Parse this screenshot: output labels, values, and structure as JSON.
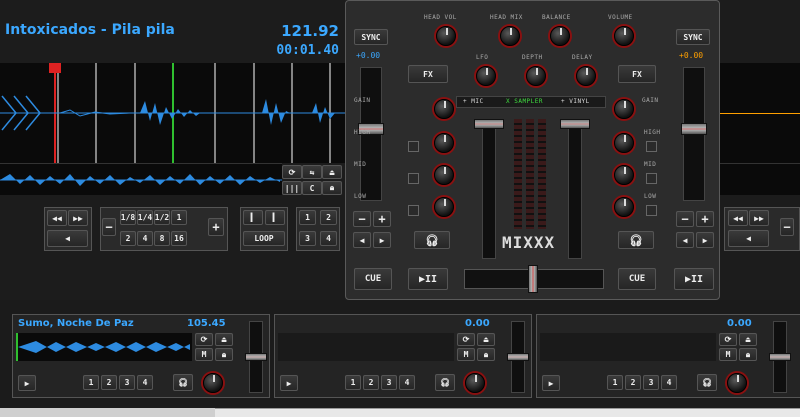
{
  "deck1": {
    "title": "Intoxicados - Pila pila",
    "bpm": "121.92",
    "time": "00:01.40",
    "pitch": "+0.00",
    "sync_label": "SYNC",
    "fx_label": "FX",
    "cue_label": "CUE",
    "play_label": "▶II",
    "loop_label": "LOOP",
    "loop_sizes_top": [
      "1/8",
      "1/4",
      "1/2",
      "1"
    ],
    "loop_sizes_bottom": [
      "2",
      "4",
      "8",
      "16"
    ],
    "hotcues_top": [
      "1",
      "2"
    ],
    "hotcues_bottom": [
      "3",
      "4"
    ],
    "minus": "−",
    "plus": "+"
  },
  "deck2": {
    "pitch": "+0.00",
    "sync_label": "SYNC",
    "fx_label": "FX",
    "cue_label": "CUE",
    "play_label": "▶II"
  },
  "mixer": {
    "top_knobs": [
      "HEAD VOL",
      "HEAD MIX",
      "BALANCE",
      "VOLUME"
    ],
    "mid_knobs": [
      "LFO",
      "DEPTH",
      "DELAY"
    ],
    "eq_labels": [
      "GAIN",
      "HIGH",
      "MID",
      "LOW"
    ],
    "channel_select": [
      "+ MIC",
      "X SAMPLER",
      "+ VINYL"
    ],
    "logo": "MIXXX"
  },
  "samplers": [
    {
      "title": "Sumo, Noche De Paz",
      "bpm": "105.45",
      "pads": [
        "1",
        "2",
        "3",
        "4"
      ],
      "play": "▶"
    },
    {
      "title": "",
      "bpm": "0.00",
      "pads": [
        "1",
        "2",
        "3",
        "4"
      ],
      "play": "▶"
    },
    {
      "title": "",
      "bpm": "0.00",
      "pads": [
        "1",
        "2",
        "3",
        "4"
      ],
      "play": "▶"
    }
  ],
  "colors": {
    "accent": "#3ba8ff",
    "pitch_right": "#ffa000",
    "waveform": "#2d8be0",
    "knob_ring": "#8a1010"
  },
  "icons": [
    "headphones-icon",
    "eject-icon",
    "lock-icon",
    "repeat-icon",
    "rewind-icon",
    "fast-forward-icon"
  ]
}
